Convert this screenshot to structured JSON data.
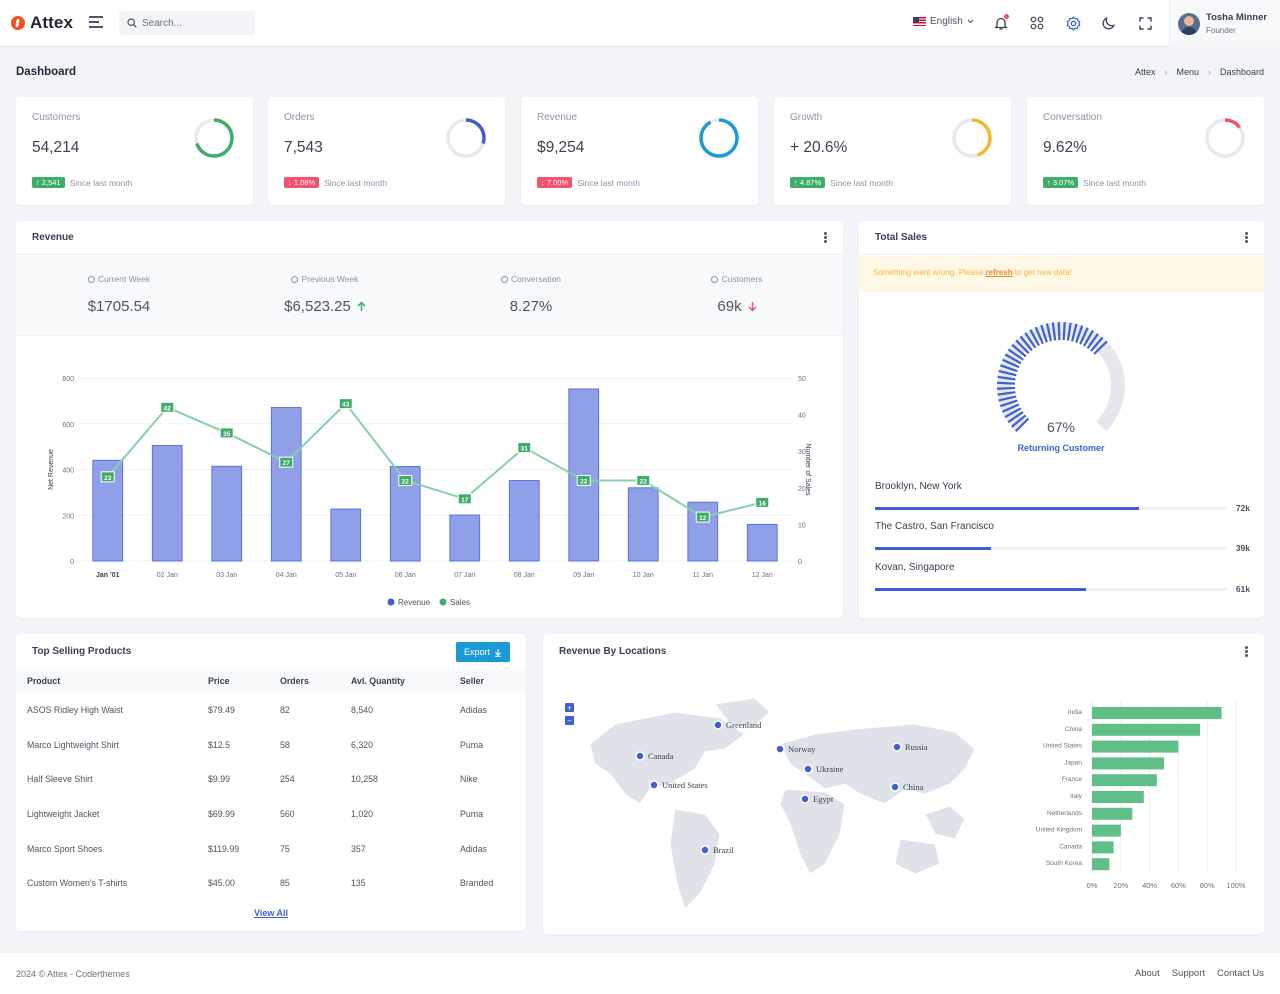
{
  "app": {
    "name": "Attex"
  },
  "search": {
    "placeholder": "Search..."
  },
  "language": {
    "selected": "English"
  },
  "user": {
    "name": "Tosha Minner",
    "role": "Founder"
  },
  "page": {
    "title": "Dashboard",
    "breadcrumb": [
      "Attex",
      "Menu",
      "Dashboard"
    ]
  },
  "stats": [
    {
      "label": "Customers",
      "value": "54,214",
      "change": "2,541",
      "trend": "up",
      "since": "Since last month",
      "progress": 0.7,
      "color": "#3fad6a"
    },
    {
      "label": "Orders",
      "value": "7,543",
      "change": "1.08%",
      "trend": "down",
      "since": "Since last month",
      "progress": 0.3,
      "color": "#3f5fd1"
    },
    {
      "label": "Revenue",
      "value": "$9,254",
      "change": "7.00%",
      "trend": "down",
      "since": "Since last month",
      "progress": 0.92,
      "color": "#1c9ad6"
    },
    {
      "label": "Growth",
      "value": "+ 20.6%",
      "change": "4.87%",
      "trend": "up",
      "since": "Since last month",
      "progress": 0.45,
      "color": "#f5b731"
    },
    {
      "label": "Conversation",
      "value": "9.62%",
      "change": "3.07%",
      "trend": "up",
      "since": "Since last month",
      "progress": 0.15,
      "color": "#f4516c"
    }
  ],
  "revenue_card": {
    "title": "Revenue",
    "summary": [
      {
        "label": "Current Week",
        "value": "$1705.54",
        "trend": ""
      },
      {
        "label": "Previous Week",
        "value": "$6,523.25",
        "trend": "up"
      },
      {
        "label": "Conversation",
        "value": "8.27%",
        "trend": ""
      },
      {
        "label": "Customers",
        "value": "69k",
        "trend": "down"
      }
    ]
  },
  "chart_data": {
    "type": "bar",
    "categories": [
      "Jan '01",
      "02 Jan",
      "03 Jan",
      "04 Jan",
      "05 Jan",
      "06 Jan",
      "07 Jan",
      "08 Jan",
      "09 Jan",
      "10 Jan",
      "11 Jan",
      "12 Jan"
    ],
    "series": [
      {
        "name": "Revenue",
        "type": "bar",
        "axis": "left",
        "values": [
          440,
          505,
          414,
          671,
          227,
          413,
          201,
          352,
          752,
          320,
          257,
          160
        ],
        "color": "#8fa0e8"
      },
      {
        "name": "Sales",
        "type": "line",
        "axis": "right",
        "values": [
          23,
          42,
          35,
          27,
          43,
          22,
          17,
          31,
          22,
          22,
          12,
          16
        ],
        "color": "#86d0a6"
      }
    ],
    "ylabel": "Net Revenue",
    "y2label": "Number of Sales",
    "ylim": [
      0,
      800
    ],
    "y2lim": [
      0,
      50
    ],
    "yticks": [
      0,
      200,
      400,
      600,
      800
    ],
    "y2ticks": [
      0,
      10,
      20,
      30,
      40,
      50
    ],
    "grid": true,
    "legend": "bottom"
  },
  "total_sales": {
    "title": "Total Sales",
    "alert": {
      "before": "Something went wrong. Please ",
      "link": "refresh",
      "after": " to get new data!"
    },
    "gauge": {
      "value": 0.67,
      "label": "67%",
      "caption": "Returning Customer"
    },
    "locations": [
      {
        "name": "Brooklyn, New York",
        "value": "72k",
        "fraction": 0.75
      },
      {
        "name": "The Castro, San Francisco",
        "value": "39k",
        "fraction": 0.33
      },
      {
        "name": "Kovan, Singapore",
        "value": "61k",
        "fraction": 0.6
      }
    ]
  },
  "top_products": {
    "title": "Top Selling Products",
    "export_label": "Export",
    "columns": [
      "Product",
      "Price",
      "Orders",
      "Avl. Quantity",
      "Seller"
    ],
    "rows": [
      [
        "ASOS Ridley High Waist",
        "$79.49",
        "82",
        "8,540",
        "Adidas"
      ],
      [
        "Marco Lightweight Shirt",
        "$12.5",
        "58",
        "6,320",
        "Puma"
      ],
      [
        "Half Sleeve Shirt",
        "$9.99",
        "254",
        "10,258",
        "Nike"
      ],
      [
        "Lightweight Jacket",
        "$69.99",
        "560",
        "1,020",
        "Puma"
      ],
      [
        "Marco Sport Shoes",
        "$119.99",
        "75",
        "357",
        "Adidas"
      ],
      [
        "Custom Women's T-shirts",
        "$45.00",
        "85",
        "135",
        "Branded"
      ]
    ],
    "view_all": "View All"
  },
  "locations_card": {
    "title": "Revenue By Locations",
    "map_markers": [
      "Greenland",
      "Canada",
      "United States",
      "Norway",
      "Ukraine",
      "Egypt",
      "Russia",
      "China",
      "Brazil"
    ],
    "bars": {
      "categories": [
        "India",
        "China",
        "United States",
        "Japan",
        "France",
        "Italy",
        "Netherlands",
        "United Kingdom",
        "Canada",
        "South Korea"
      ],
      "values": [
        90,
        75,
        60,
        50,
        45,
        36,
        28,
        20,
        15,
        12
      ],
      "xticks": [
        "0%",
        "20%",
        "40%",
        "60%",
        "80%",
        "100%"
      ],
      "color": "#5fbf86"
    }
  },
  "footer": {
    "copyright": "2024 © Attex - Coderthemes",
    "links": [
      "About",
      "Support",
      "Contact Us"
    ]
  }
}
